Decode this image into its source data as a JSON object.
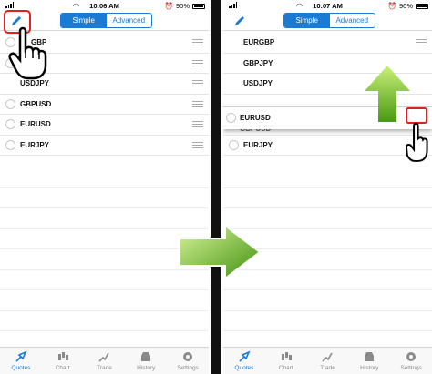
{
  "left_screen": {
    "status": {
      "time": "10:06 AM",
      "battery": "90%"
    },
    "segments": {
      "simple": "Simple",
      "advanced": "Advanced"
    },
    "symbols": [
      "EURGBP",
      "GBPJPY",
      "USDJPY",
      "GBPUSD",
      "EURUSD",
      "EURJPY"
    ],
    "visible_symbols": [
      "GBP",
      "",
      "USDJPY",
      "GBPUSD",
      "EURUSD",
      "EURJPY"
    ]
  },
  "right_screen": {
    "status": {
      "time": "10:07 AM",
      "battery": "90%"
    },
    "segments": {
      "simple": "Simple",
      "advanced": "Advanced"
    },
    "symbols": [
      "EURGBP",
      "GBPJPY",
      "USDJPY"
    ],
    "dragged_symbol": "EURUSD",
    "ghost_symbol": "GBPUSD",
    "after_symbols": [
      "EURJPY"
    ]
  },
  "tabs": [
    {
      "label": "Quotes",
      "icon": "quotes-icon"
    },
    {
      "label": "Chart",
      "icon": "chart-icon"
    },
    {
      "label": "Trade",
      "icon": "trade-icon"
    },
    {
      "label": "History",
      "icon": "history-icon"
    },
    {
      "label": "Settings",
      "icon": "settings-icon"
    }
  ],
  "colors": {
    "accent": "#1a7ad4",
    "highlight": "#e02020",
    "arrow": "#7cc52a"
  }
}
